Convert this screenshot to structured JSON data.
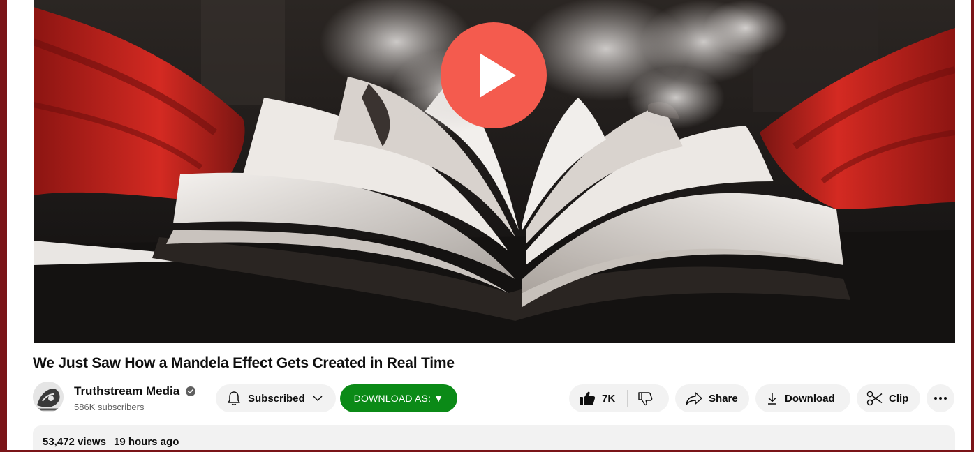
{
  "video": {
    "title": "We Just Saw How a Mandela Effect Gets Created in Real Time",
    "play_icon": "play-icon",
    "play_color": "#f45b4e"
  },
  "owner": {
    "channel_name": "Truthstream Media",
    "verified_icon": "check-circle-icon",
    "subscribers": "586K subscribers",
    "subscribe_label": "Subscribed",
    "download_as_label": "DOWNLOAD AS: ▼",
    "download_as_color": "#0b8a17"
  },
  "actions": {
    "like_count": "7K",
    "share_label": "Share",
    "download_label": "Download",
    "clip_label": "Clip",
    "more_icon": "more-horizontal-icon"
  },
  "description": {
    "views": "53,472 views",
    "time": "19 hours ago"
  }
}
